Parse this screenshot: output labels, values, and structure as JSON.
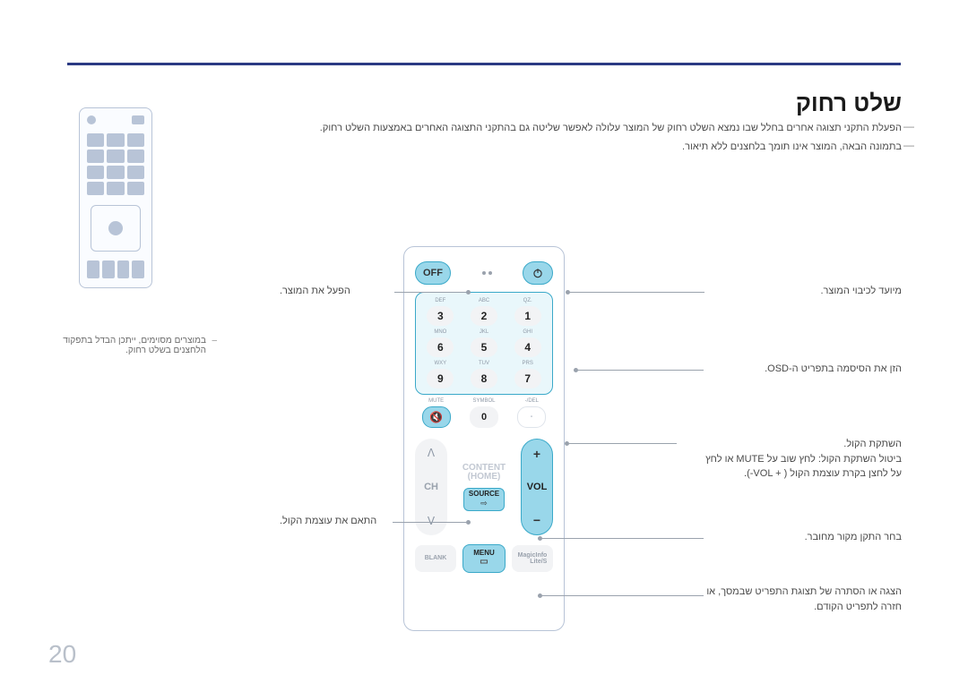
{
  "page_number": "20",
  "title": "שלט רחוק",
  "paragraphs": {
    "p1": "הפעלת התקני תצוגה אחרים בחלל שבו נמצא השלט רחוק של המוצר עלולה לאפשר שליטה גם בהתקני התצוגה האחרים באמצעות השלט רחוק.",
    "p2": "בתמונה הבאה, המוצר אינו תומך בלחצנים ללא תיאור."
  },
  "side_note": {
    "line1": "במוצרים מסוימים, ייתכן הבדל בתפקוד",
    "line2": "הלחצנים בשלט רחוק."
  },
  "remote": {
    "off_label": "OFF",
    "numpad": {
      "legends": [
        ".QZ",
        "ABC",
        "DEF",
        "GHI",
        "JKL",
        "MNO",
        "PRS",
        "TUV",
        "WXY"
      ],
      "numbers": [
        "1",
        "2",
        "3",
        "4",
        "5",
        "6",
        "7",
        "8",
        "9"
      ]
    },
    "special_row": {
      "del_legend": "DEL/-",
      "sym_legend": "SYMBOL",
      "zero": "0",
      "mute_legend": "MUTE"
    },
    "vol_label": "VOL",
    "vol_plus": "+",
    "vol_minus": "−",
    "ch_label": "CH",
    "content_home": "CONTENT\n(HOME)",
    "source_label": "SOURCE",
    "source_icon": "⇨",
    "magicinfo": "MagicInfo\nLite/S",
    "menu_label": "MENU",
    "menu_icon": "▭",
    "blank_label": "BLANK"
  },
  "callouts": {
    "power_on": "הפעל את המוצר.",
    "power_off": "מיועד לכיבוי המוצר.",
    "numpad": "הזן את הסיסמה בתפריט ה-OSD.",
    "mute_l1": "השתקת הקול.",
    "mute_l2": "ביטול השתקת הקול: לחץ שוב על MUTE או לחץ",
    "mute_l3": "על לחצן בקרת עוצמת הקול (VOL + ‎-).",
    "volume": "התאם את עוצמת הקול.",
    "source": "בחר התקן מקור מחובר.",
    "menu_l1": "הצגה או הסתרה של תצוגת התפריט שבמסך, או",
    "menu_l2": "חזרה לתפריט הקודם."
  }
}
